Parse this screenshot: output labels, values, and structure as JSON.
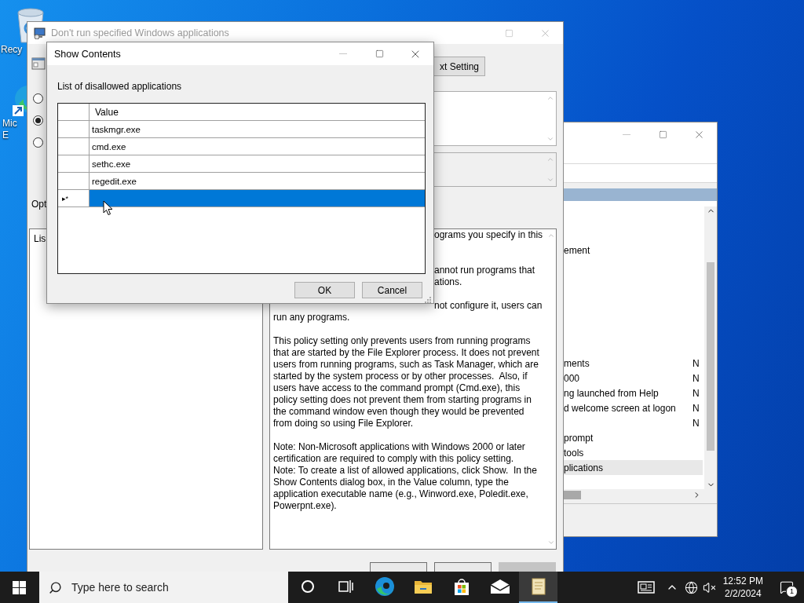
{
  "desktop_icons": [
    {
      "kind": "recycle",
      "label": [
        "Recy"
      ]
    },
    {
      "kind": "edge",
      "label": [
        "Mic",
        "E"
      ]
    }
  ],
  "back_window": {
    "top_item": "ement",
    "rows": [
      {
        "name": "ments",
        "state": "N",
        "selected": false
      },
      {
        "name": "000",
        "state": "N",
        "selected": false
      },
      {
        "name": "ng launched from Help",
        "state": "N",
        "selected": false
      },
      {
        "name": "d welcome screen at logon",
        "state": "N",
        "selected": false
      },
      {
        "state": "N",
        "selected": false
      },
      {
        "name": "prompt",
        "selected": false
      },
      {
        "name": "tools",
        "selected": false
      },
      {
        "name": "plications",
        "selected": true
      }
    ]
  },
  "policy_window": {
    "title": "Don't run specified Windows applications",
    "active": false,
    "setting_button": "xt Setting",
    "radios": [
      {
        "selected": false
      },
      {
        "selected": true
      },
      {
        "selected": false
      }
    ],
    "options_label": "Opt",
    "options_text": "Lis",
    "help_fragments": [
      [
        "ograms you specify in this"
      ],
      [
        "annot run programs that",
        "ations."
      ],
      [
        "not configure it, users can"
      ]
    ],
    "help_paragraphs": [
      [
        "run any programs."
      ],
      [
        "This policy setting only prevents users from running programs that are started by the File Explorer process. It does not prevent users from running programs, such as Task Manager, which are started by the system process or by other processes.  Also, if users have access to the command prompt (Cmd.exe), this policy setting does not prevent them from starting programs in the command window even though they would be prevented from doing so using File Explorer."
      ],
      [
        "Note: Non-Microsoft applications with Windows 2000 or later certification are required to comply with this policy setting.",
        "Note: To create a list of allowed applications, click Show.  In the Show Contents dialog box, in the Value column, type the application executable name (e.g., Winword.exe, Poledit.exe, Powerpnt.exe)."
      ]
    ],
    "bottom_buttons": [
      {
        "disabled": false
      },
      {
        "disabled": false
      },
      {
        "disabled": true
      }
    ]
  },
  "dialog": {
    "title": "Show Contents",
    "label": "List of disallowed applications",
    "column": "Value",
    "rows": [
      {
        "value": "taskmgr.exe",
        "selected": false
      },
      {
        "value": "cmd.exe",
        "selected": false
      },
      {
        "value": "sethc.exe",
        "selected": false
      },
      {
        "value": "regedit.exe",
        "selected": false
      },
      {
        "marker": "▸*",
        "selected": true
      }
    ],
    "buttons": [
      "OK",
      "Cancel"
    ]
  },
  "taskbar": {
    "search_placeholder": "Type here to search",
    "apps": [
      {
        "kind": "cortana",
        "active": false
      },
      {
        "kind": "taskview",
        "active": false
      },
      {
        "kind": "edge",
        "active": false
      },
      {
        "kind": "explorer",
        "active": false
      },
      {
        "kind": "store",
        "active": false
      },
      {
        "kind": "mail",
        "active": false
      },
      {
        "kind": "notes",
        "active": true
      }
    ],
    "time": "12:52 PM",
    "date": "2/2/2024",
    "notification_count": "1"
  }
}
